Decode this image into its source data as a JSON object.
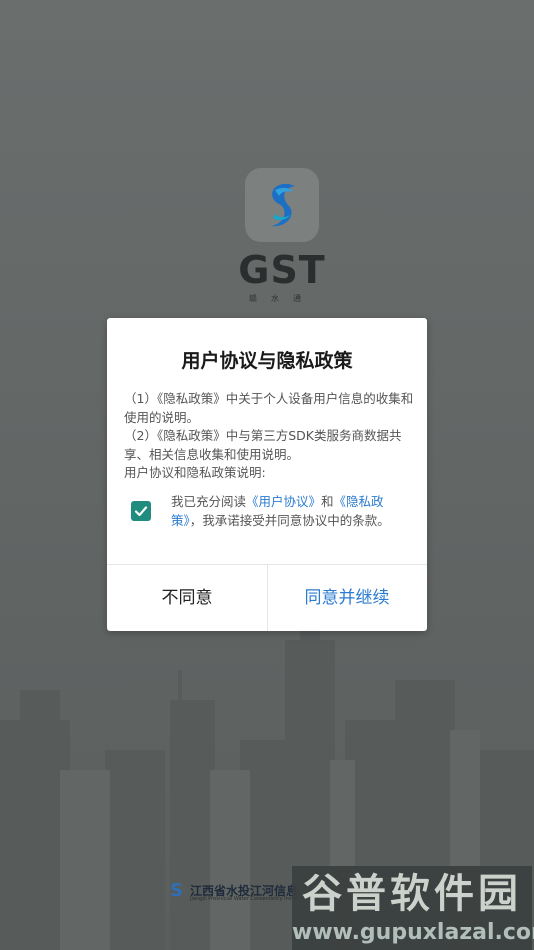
{
  "splash": {
    "brand_text": "GST",
    "brand_sub": "赣水通",
    "footer_org": "江西省水投江河信息",
    "footer_small": "Jiangxi Provincial Water Conservancy Investment"
  },
  "dialog": {
    "title": "用户协议与隐私政策",
    "paragraphs": [
      "（1）《隐私政策》中关于个人设备用户信息的收集和使用的说明。",
      "（2）《隐私政策》中与第三方SDK类服务商数据共享、相关信息收集和使用说明。",
      "用户协议和隐私政策说明:"
    ],
    "agree_prefix": "我已充分阅读",
    "user_agreement_link": "《用户协议》",
    "and_text": "和",
    "privacy_link": "《隐私政策》",
    "agree_suffix": "，我承诺接受并同意协议中的条款。",
    "checkbox_checked": true,
    "disagree_label": "不同意",
    "agree_label": "同意并继续",
    "accent_color": "#2b7bd0",
    "checkbox_color": "#1f8c7e"
  },
  "watermark": {
    "title": "谷普软件园",
    "url": "www.gupuxlazal.com"
  }
}
